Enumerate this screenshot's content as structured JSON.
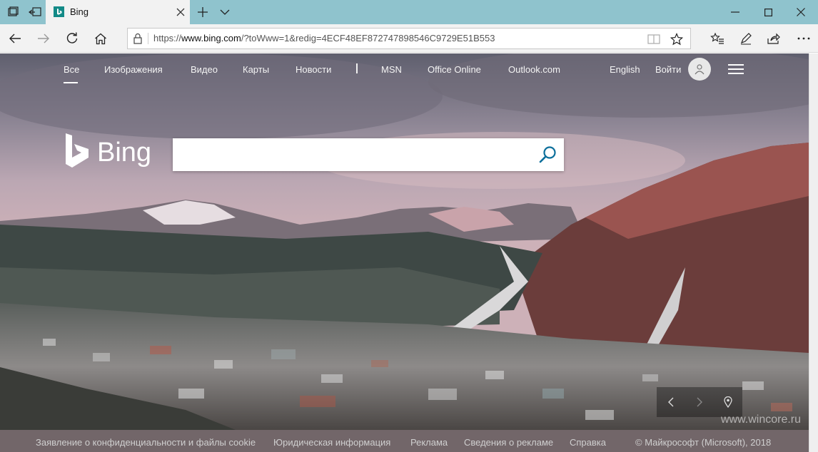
{
  "tab": {
    "title": "Bing"
  },
  "address": {
    "url_prefix": "https://",
    "url_host": "www.bing.com",
    "url_rest": "/?toWww=1&redig=4ECF48EF872747898546C9729E51B553"
  },
  "nav": {
    "items": [
      "Все",
      "Изображения",
      "Видео",
      "Карты",
      "Новости",
      "MSN",
      "Office Online",
      "Outlook.com"
    ],
    "language": "English",
    "signin": "Войти"
  },
  "logo": {
    "text": "Bing"
  },
  "search": {
    "value": "",
    "placeholder": ""
  },
  "footer": {
    "links": [
      "Заявление о конфиденциальности и файлы cookie",
      "Юридическая информация",
      "Реклама",
      "Сведения о рекламе",
      "Справка"
    ],
    "copyright": "© Майкрософт (Microsoft), 2018"
  },
  "watermark": "www.wincore.ru",
  "colors": {
    "tabbar": "#8fc3cd",
    "bing_teal": "#138a87",
    "search_icon": "#0c6f9b"
  },
  "icons": [
    "tab-manager-icon",
    "set-aside-tabs-icon",
    "bing-favicon",
    "close-icon",
    "new-tab-icon",
    "chevron-down-icon",
    "minimize-icon",
    "maximize-icon",
    "back-icon",
    "forward-icon",
    "refresh-icon",
    "home-icon",
    "lock-icon",
    "reading-view-icon",
    "favorite-star-icon",
    "favorites-hub-icon",
    "pen-icon",
    "share-icon",
    "more-icon",
    "user-icon",
    "hamburger-icon",
    "search-icon",
    "prev-image-icon",
    "next-image-icon",
    "location-pin-icon"
  ]
}
